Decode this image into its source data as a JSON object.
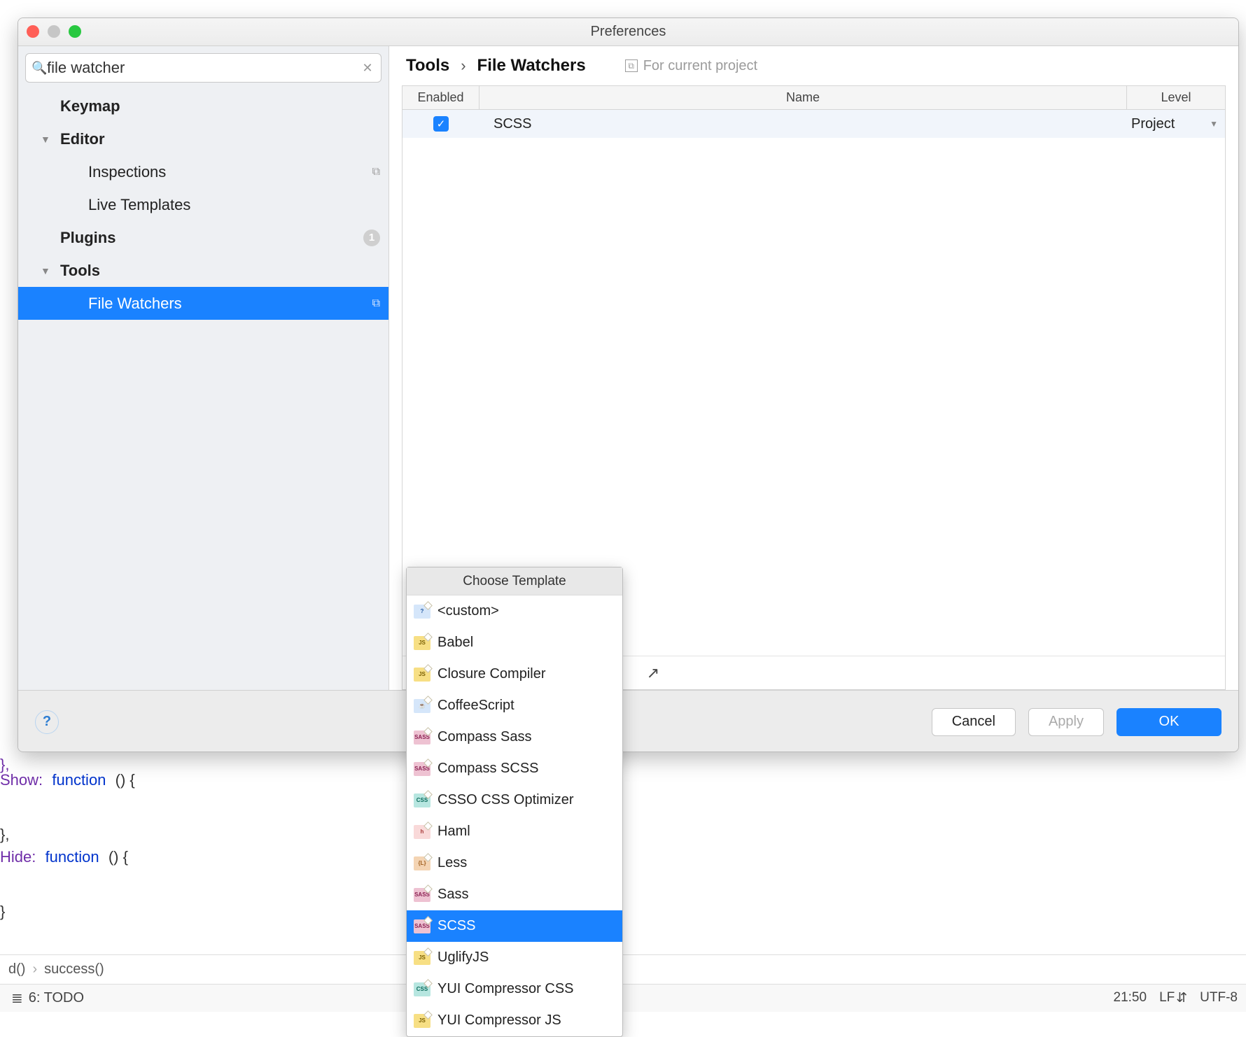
{
  "window": {
    "title": "Preferences"
  },
  "search": {
    "value": "file watcher"
  },
  "sidebar": {
    "items": [
      {
        "label": "Keymap",
        "type": "leaf",
        "depth": 1,
        "bold": true
      },
      {
        "label": "Editor",
        "type": "branch",
        "depth": 1,
        "bold": true,
        "expanded": true
      },
      {
        "label": "Inspections",
        "type": "leaf",
        "depth": 2,
        "copyable": true
      },
      {
        "label": "Live Templates",
        "type": "leaf",
        "depth": 2
      },
      {
        "label": "Plugins",
        "type": "leaf",
        "depth": 1,
        "bold": true,
        "count": 1
      },
      {
        "label": "Tools",
        "type": "branch",
        "depth": 1,
        "bold": true,
        "expanded": true
      },
      {
        "label": "File Watchers",
        "type": "leaf",
        "depth": 2,
        "selected": true,
        "copyable": true
      }
    ]
  },
  "breadcrumb": {
    "root": "Tools",
    "leaf": "File Watchers",
    "scope": "For current project"
  },
  "table": {
    "headers": {
      "enabled": "Enabled",
      "name": "Name",
      "level": "Level"
    },
    "rows": [
      {
        "enabled": true,
        "name": "SCSS",
        "level": "Project"
      }
    ]
  },
  "actions": {
    "cancel": "Cancel",
    "apply": "Apply",
    "ok": "OK"
  },
  "popup": {
    "title": "Choose Template",
    "items": [
      {
        "label": "<custom>",
        "icon": "q"
      },
      {
        "label": "Babel",
        "icon": "js"
      },
      {
        "label": "Closure Compiler",
        "icon": "js"
      },
      {
        "label": "CoffeeScript",
        "icon": "q"
      },
      {
        "label": "Compass Sass",
        "icon": "sass"
      },
      {
        "label": "Compass SCSS",
        "icon": "sass"
      },
      {
        "label": "CSSO CSS Optimizer",
        "icon": "css"
      },
      {
        "label": "Haml",
        "icon": "h"
      },
      {
        "label": "Less",
        "icon": "l"
      },
      {
        "label": "Sass",
        "icon": "sass"
      },
      {
        "label": "SCSS",
        "icon": "sass",
        "selected": true
      },
      {
        "label": "UglifyJS",
        "icon": "js"
      },
      {
        "label": "YUI Compressor CSS",
        "icon": "css"
      },
      {
        "label": "YUI Compressor JS",
        "icon": "js"
      }
    ]
  },
  "editor_bg": {
    "show": "Show:",
    "hide": "Hide:",
    "fn_kw": "function",
    "parens": "() {",
    "brace": "}",
    "brace_comma": "},"
  },
  "bottom_breadcrumb": {
    "a": "d()",
    "b": "success()"
  },
  "todo": {
    "label": "6: TODO"
  },
  "status": {
    "pos": "21:50",
    "lineend": "LF",
    "enc": "UTF-8"
  }
}
